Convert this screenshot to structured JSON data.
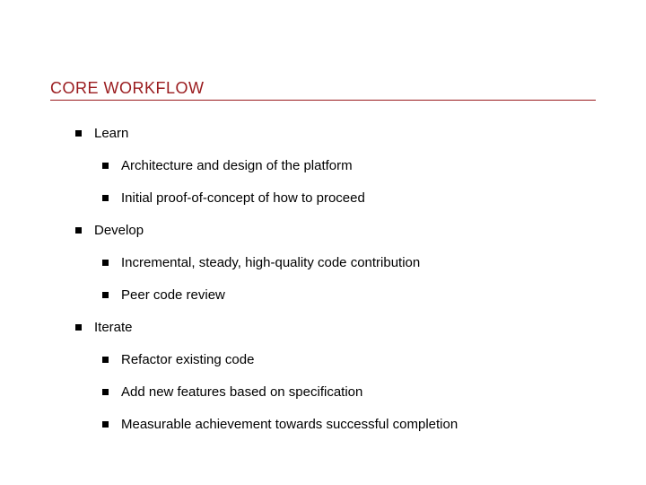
{
  "title": "CORE WORKFLOW",
  "sections": [
    {
      "label": "Learn",
      "items": [
        "Architecture and design of the platform",
        "Initial proof-of-concept of how to proceed"
      ]
    },
    {
      "label": "Develop",
      "items": [
        "Incremental, steady, high-quality code contribution",
        "Peer code review"
      ]
    },
    {
      "label": "Iterate",
      "items": [
        "Refactor existing code",
        "Add new features based on specification",
        "Measurable achievement towards successful completion"
      ]
    }
  ]
}
